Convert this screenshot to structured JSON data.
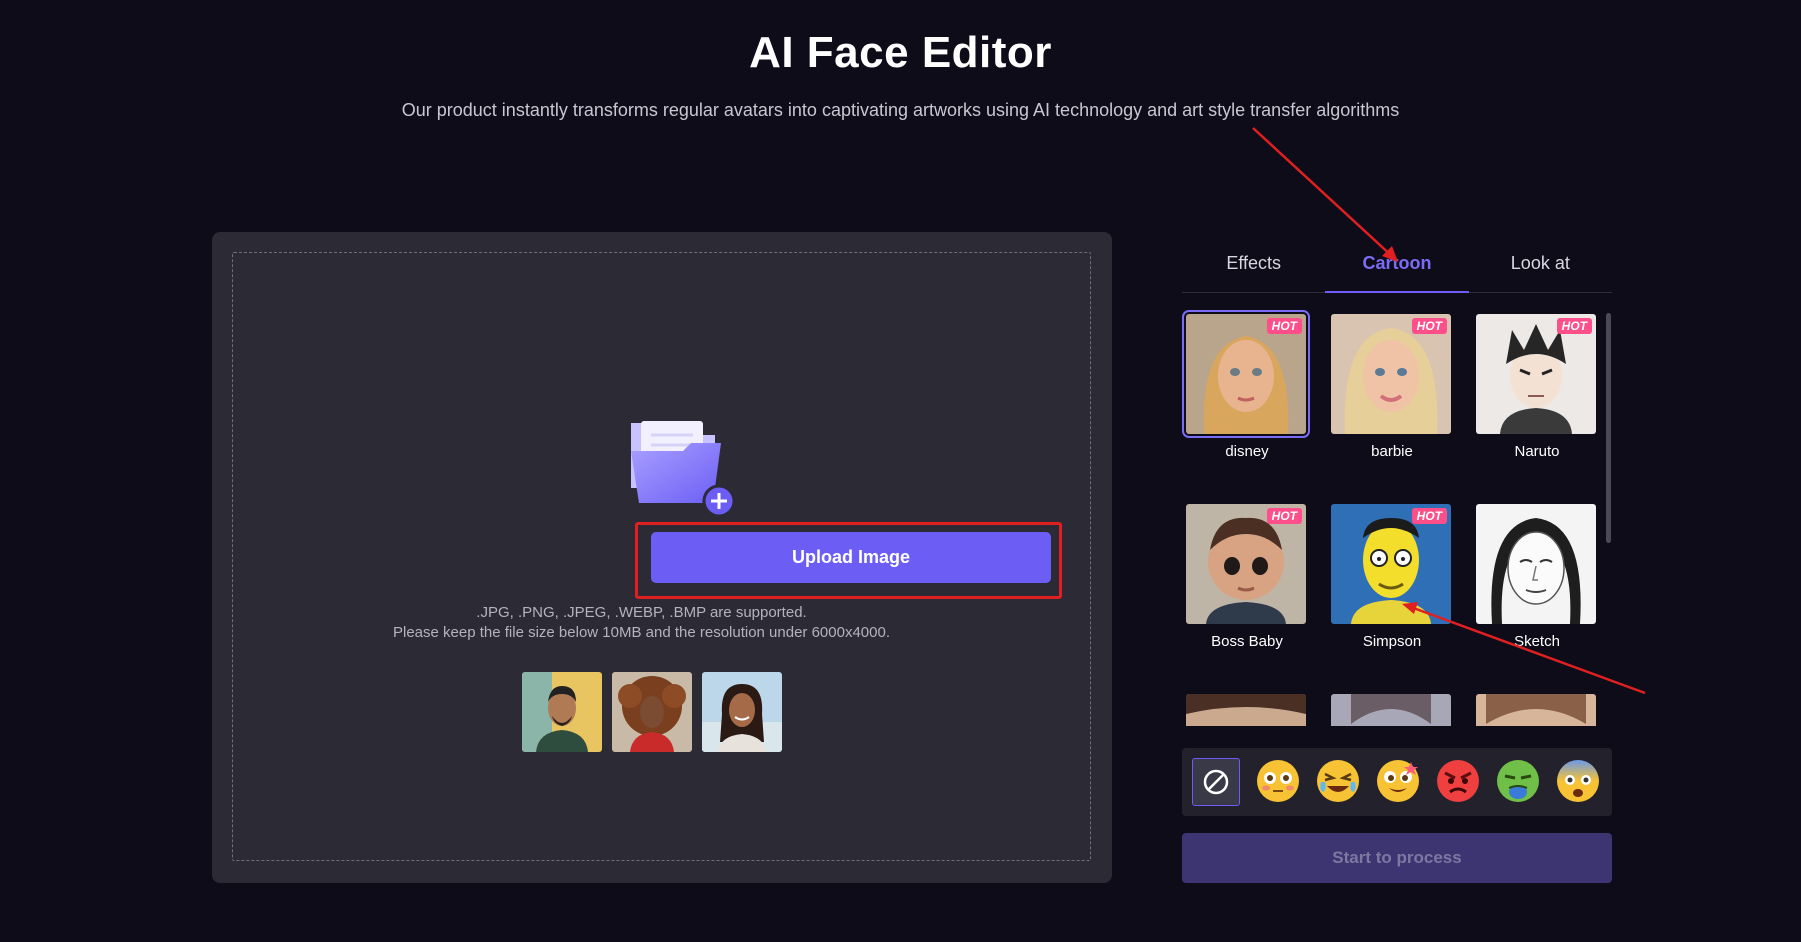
{
  "header": {
    "title": "AI Face Editor",
    "subtitle": "Our product instantly transforms regular avatars into captivating artworks using AI technology and art style transfer algorithms"
  },
  "upload": {
    "button_label": "Upload Image",
    "formats_text": ".JPG, .PNG, .JPEG, .WEBP, .BMP are supported.",
    "limits_text": "Please keep the file size below 10MB and the resolution under 6000x4000.",
    "samples": [
      "sample-man",
      "sample-woman-curly",
      "sample-woman-smiling"
    ]
  },
  "tabs": [
    {
      "label": "Effects",
      "active": false
    },
    {
      "label": "Cartoon",
      "active": true
    },
    {
      "label": "Look at",
      "active": false
    }
  ],
  "styles": [
    {
      "label": "disney",
      "hot": true,
      "selected": true
    },
    {
      "label": "barbie",
      "hot": true,
      "selected": false
    },
    {
      "label": "Naruto",
      "hot": true,
      "selected": false
    },
    {
      "label": "Boss Baby",
      "hot": true,
      "selected": false
    },
    {
      "label": "Simpson",
      "hot": true,
      "selected": false
    },
    {
      "label": "Sketch",
      "hot": false,
      "selected": false
    }
  ],
  "hot_badge": "HOT",
  "emojis": [
    "none-icon",
    "flushed-emoji",
    "crying-laughing-emoji",
    "star-struck-emoji",
    "angry-emoji",
    "nauseated-emoji",
    "fearful-emoji"
  ],
  "process_button": "Start to process",
  "colors": {
    "accent": "#6c5ef5",
    "background": "#0e0c19",
    "panel": "#2b2a35",
    "hot": "#ff4f8b",
    "annotation": "#e02020"
  }
}
